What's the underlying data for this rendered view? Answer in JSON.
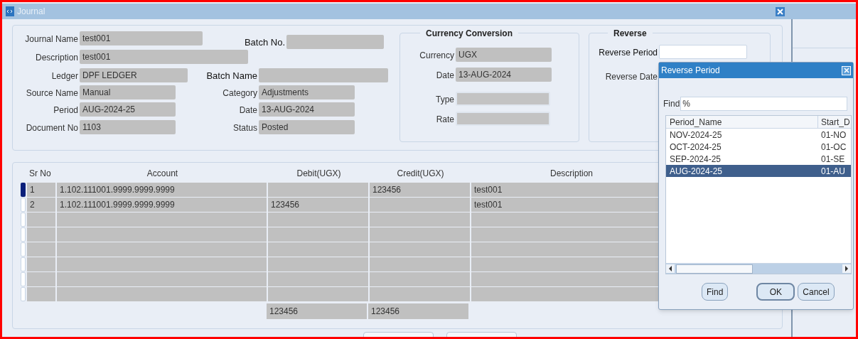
{
  "window": {
    "title": "Journal"
  },
  "header": {
    "journal_name": {
      "label": "Journal Name",
      "value": "test001"
    },
    "batch_no": {
      "label": "Batch No."
    },
    "description": {
      "label": "Description",
      "value": "test001"
    },
    "ledger": {
      "label": "Ledger",
      "value": "DPF LEDGER"
    },
    "batch_name": {
      "label": "Batch Name"
    },
    "source_name": {
      "label": "Source Name",
      "value": "Manual"
    },
    "category": {
      "label": "Category",
      "value": "Adjustments"
    },
    "period": {
      "label": "Period",
      "value": "AUG-2024-25"
    },
    "date": {
      "label": "Date",
      "value": "13-AUG-2024"
    },
    "document_no": {
      "label": "Document No",
      "value": "1103"
    },
    "status": {
      "label": "Status",
      "value": "Posted"
    }
  },
  "currency_conversion": {
    "title": "Currency Conversion",
    "fields": [
      {
        "label": "Currency",
        "value": "UGX",
        "disabled": false
      },
      {
        "label": "Date",
        "value": "13-AUG-2024",
        "disabled": false
      },
      {
        "label": "Type",
        "disabled": true
      },
      {
        "label": "Rate",
        "disabled": true
      }
    ]
  },
  "reverse": {
    "title": "Reverse",
    "reverse_period": {
      "label": "Reverse Period"
    },
    "reverse_date": {
      "label": "Reverse Date"
    }
  },
  "lines": {
    "columns": [
      "Sr No",
      "Account",
      "Debit(UGX)",
      "Credit(UGX)",
      "Description"
    ],
    "rows": [
      {
        "selected": true,
        "cells": [
          "1",
          "1.102.111001.9999.9999.9999",
          "",
          "123456",
          "test001"
        ]
      },
      {
        "selected": false,
        "cells": [
          "2",
          "1.102.111001.9999.9999.9999",
          "123456",
          "",
          "test001"
        ]
      }
    ],
    "totals": [
      "123456",
      "123456"
    ]
  },
  "dialog": {
    "title": "Reverse Period",
    "find": {
      "label": "Find",
      "value": "%"
    },
    "columns": [
      "Period_Name",
      "Start_D"
    ],
    "rows": [
      {
        "selected": false,
        "cells": [
          "NOV-2024-25",
          "01-NO"
        ]
      },
      {
        "selected": false,
        "cells": [
          "OCT-2024-25",
          "01-OC"
        ]
      },
      {
        "selected": false,
        "cells": [
          "SEP-2024-25",
          "01-SE"
        ]
      },
      {
        "selected": true,
        "cells": [
          "AUG-2024-25",
          "01-AU"
        ]
      }
    ],
    "buttons": [
      {
        "label": "Find",
        "default": false
      },
      {
        "label": "OK",
        "default": true
      },
      {
        "label": "Cancel",
        "default": false
      }
    ]
  }
}
